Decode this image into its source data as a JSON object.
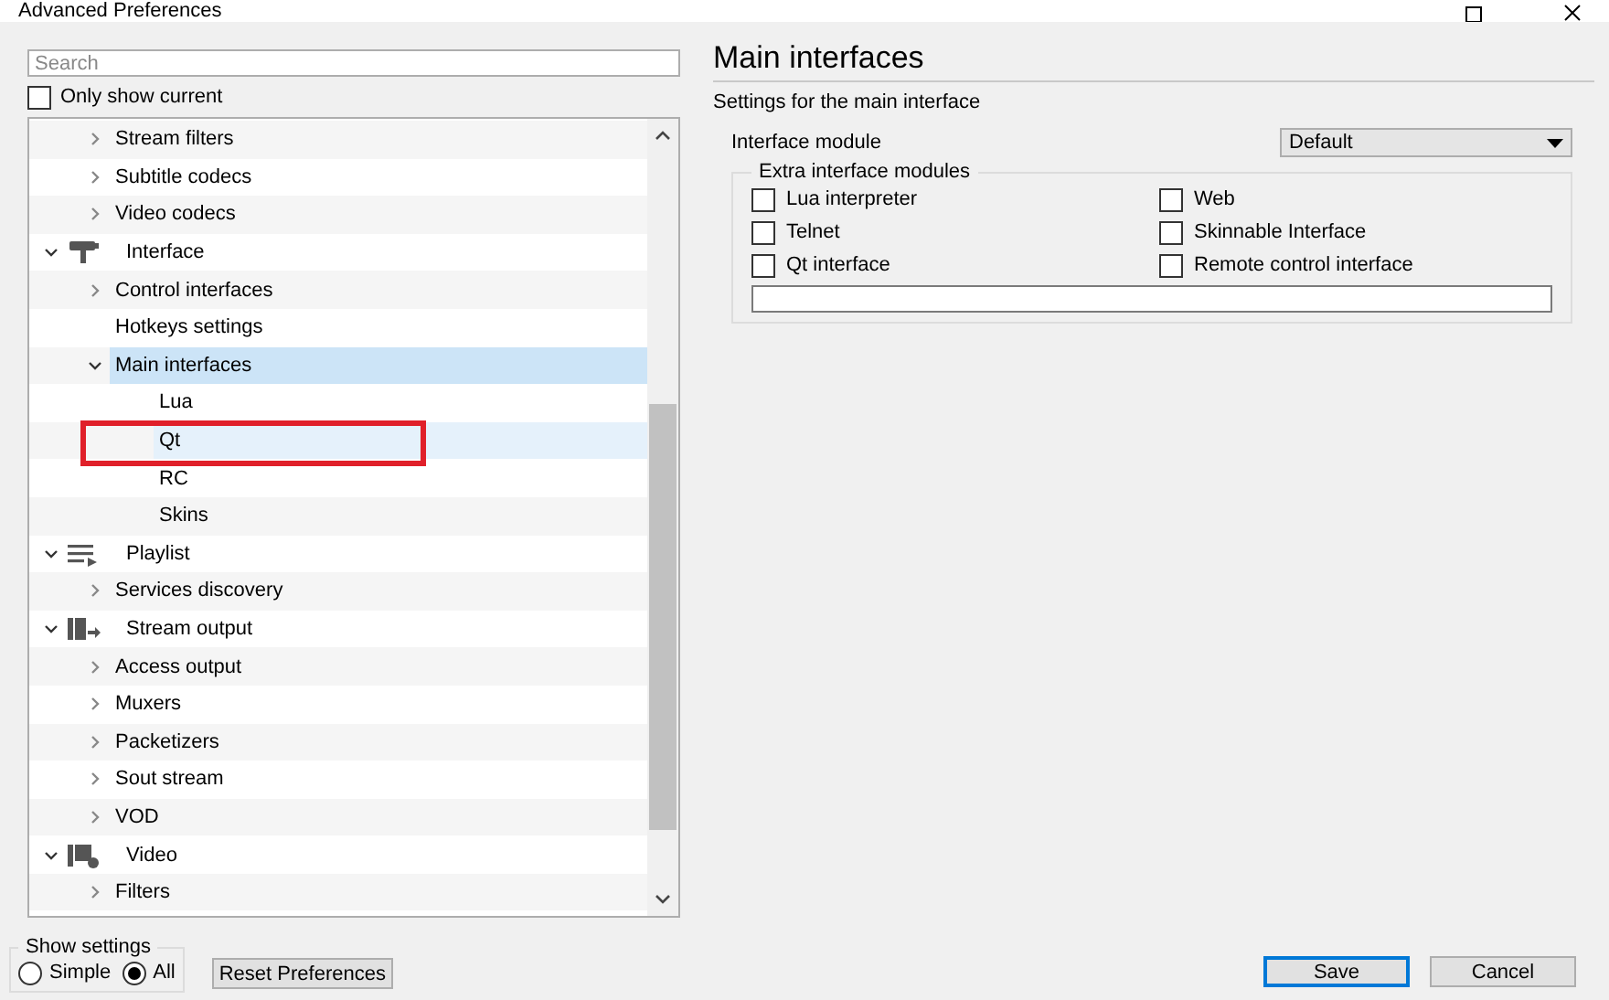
{
  "window": {
    "title": "Advanced Preferences"
  },
  "search": {
    "placeholder": "Search"
  },
  "only_show_current": {
    "label": "Only show current",
    "checked": false
  },
  "tree": {
    "continued_children": [
      {
        "label": "Stream filters",
        "expanded": false,
        "selected": false,
        "hovered": false
      },
      {
        "label": "Subtitle codecs",
        "expanded": false,
        "selected": false,
        "hovered": false
      },
      {
        "label": "Video codecs",
        "expanded": false,
        "selected": false,
        "hovered": false
      }
    ],
    "items": [
      {
        "label": "Interface",
        "expanded": true,
        "selected": false,
        "hovered": false,
        "children": [
          {
            "label": "Control interfaces",
            "expanded": false,
            "selected": false,
            "hovered": false
          },
          {
            "label": "Hotkeys settings",
            "selected": false,
            "hovered": false
          },
          {
            "label": "Main interfaces",
            "expanded": true,
            "selected": true,
            "hovered": false,
            "children": [
              {
                "label": "Lua",
                "selected": false,
                "hovered": false
              },
              {
                "label": "Qt",
                "selected": false,
                "hovered": true,
                "annotated": true
              },
              {
                "label": "RC",
                "selected": false,
                "hovered": false
              },
              {
                "label": "Skins",
                "selected": false,
                "hovered": false
              }
            ]
          }
        ]
      },
      {
        "label": "Playlist",
        "expanded": true,
        "selected": false,
        "hovered": false,
        "children": [
          {
            "label": "Services discovery",
            "expanded": false,
            "selected": false,
            "hovered": false
          }
        ]
      },
      {
        "label": "Stream output",
        "expanded": true,
        "selected": false,
        "hovered": false,
        "children": [
          {
            "label": "Access output",
            "expanded": false,
            "selected": false,
            "hovered": false
          },
          {
            "label": "Muxers",
            "expanded": false,
            "selected": false,
            "hovered": false
          },
          {
            "label": "Packetizers",
            "expanded": false,
            "selected": false,
            "hovered": false
          },
          {
            "label": "Sout stream",
            "expanded": false,
            "selected": false,
            "hovered": false
          },
          {
            "label": "VOD",
            "expanded": false,
            "selected": false,
            "hovered": false
          }
        ]
      },
      {
        "label": "Video",
        "expanded": true,
        "selected": false,
        "hovered": false,
        "children": [
          {
            "label": "Filters",
            "expanded": false,
            "selected": false,
            "hovered": false
          }
        ]
      }
    ]
  },
  "show_settings": {
    "title": "Show settings",
    "options": [
      {
        "label": "Simple",
        "selected": false
      },
      {
        "label": "All",
        "selected": true
      }
    ]
  },
  "reset_button": "Reset Preferences",
  "panel": {
    "title": "Main interfaces",
    "subtitle": "Settings for the main interface",
    "interface_module": {
      "label": "Interface module",
      "value": "Default"
    },
    "extra_modules": {
      "title": "Extra interface modules",
      "options": [
        {
          "label": "Lua interpreter",
          "checked": false
        },
        {
          "label": "Web",
          "checked": false
        },
        {
          "label": "Telnet",
          "checked": false
        },
        {
          "label": "Skinnable Interface",
          "checked": false
        },
        {
          "label": "Qt interface",
          "checked": false
        },
        {
          "label": "Remote control interface",
          "checked": false
        }
      ]
    }
  },
  "buttons": [
    {
      "label": "Save",
      "default": true
    },
    {
      "label": "Cancel",
      "default": false
    }
  ]
}
